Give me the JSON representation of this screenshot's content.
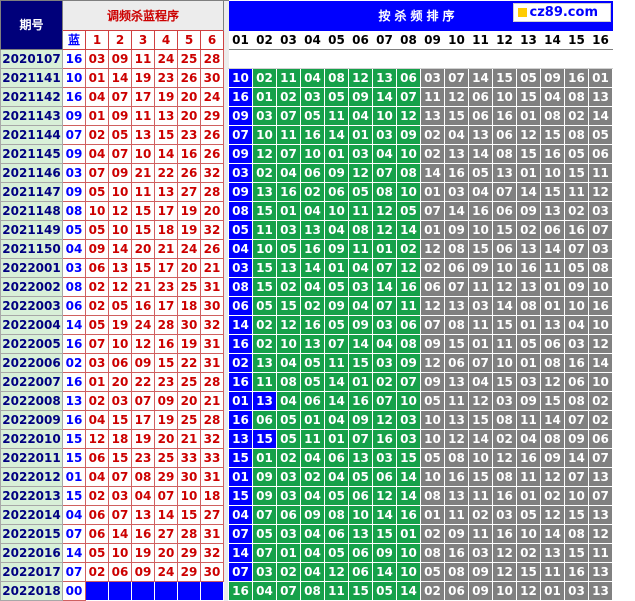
{
  "header": {
    "period_label": "期号",
    "adjust_label": "调频杀蓝程序",
    "kill_label": "按杀频排序",
    "logo_text": "cz89.com",
    "blue_col_label": "蓝",
    "rank_labels": [
      "1",
      "2",
      "3",
      "4",
      "5",
      "6"
    ],
    "kill_col_labels": [
      "01",
      "02",
      "03",
      "04",
      "05",
      "06",
      "07",
      "08",
      "09",
      "10",
      "11",
      "12",
      "13",
      "14",
      "15",
      "16"
    ]
  },
  "colors": {
    "blue": "#0000ff",
    "green": "#16a14a",
    "gray": "#808080",
    "period_bg": "#d8f0d8",
    "red_text": "#cc0000"
  },
  "subheader_period": "2020107",
  "subheader_values": [
    "16",
    "03",
    "09",
    "11",
    "24",
    "25",
    "28"
  ],
  "rows": [
    {
      "period": "2021141",
      "blue": "10",
      "reds": [
        "01",
        "14",
        "19",
        "23",
        "26",
        "30"
      ],
      "kill": [
        "10",
        "02",
        "11",
        "04",
        "08",
        "12",
        "13",
        "06",
        "03",
        "07",
        "14",
        "15",
        "05",
        "09",
        "16",
        "01"
      ],
      "split": [
        1,
        8
      ]
    },
    {
      "period": "2021142",
      "blue": "16",
      "reds": [
        "04",
        "07",
        "17",
        "19",
        "20",
        "24"
      ],
      "kill": [
        "16",
        "01",
        "02",
        "03",
        "05",
        "09",
        "14",
        "07",
        "11",
        "12",
        "06",
        "10",
        "15",
        "04",
        "08",
        "13"
      ],
      "split": [
        1,
        8
      ]
    },
    {
      "period": "2021143",
      "blue": "09",
      "reds": [
        "01",
        "09",
        "11",
        "13",
        "20",
        "29"
      ],
      "kill": [
        "09",
        "03",
        "07",
        "05",
        "11",
        "04",
        "10",
        "12",
        "13",
        "15",
        "06",
        "16",
        "01",
        "08",
        "02",
        "14"
      ],
      "split": [
        1,
        8
      ]
    },
    {
      "period": "2021144",
      "blue": "07",
      "reds": [
        "02",
        "05",
        "13",
        "15",
        "23",
        "26"
      ],
      "kill": [
        "07",
        "10",
        "11",
        "16",
        "14",
        "01",
        "03",
        "09",
        "02",
        "04",
        "13",
        "06",
        "12",
        "15",
        "08",
        "05"
      ],
      "split": [
        1,
        8
      ]
    },
    {
      "period": "2021145",
      "blue": "09",
      "reds": [
        "04",
        "07",
        "10",
        "14",
        "16",
        "26"
      ],
      "kill": [
        "09",
        "12",
        "07",
        "10",
        "01",
        "03",
        "04",
        "10",
        "02",
        "13",
        "14",
        "08",
        "15",
        "16",
        "05",
        "06"
      ],
      "split": [
        1,
        8
      ]
    },
    {
      "period": "2021146",
      "blue": "03",
      "reds": [
        "07",
        "09",
        "21",
        "22",
        "26",
        "32"
      ],
      "kill": [
        "03",
        "02",
        "04",
        "06",
        "09",
        "12",
        "07",
        "08",
        "14",
        "16",
        "05",
        "13",
        "01",
        "10",
        "15",
        "11"
      ],
      "split": [
        1,
        8
      ]
    },
    {
      "period": "2021147",
      "blue": "09",
      "reds": [
        "05",
        "10",
        "11",
        "13",
        "27",
        "28"
      ],
      "kill": [
        "09",
        "13",
        "16",
        "02",
        "06",
        "05",
        "08",
        "10",
        "01",
        "03",
        "04",
        "07",
        "14",
        "15",
        "11",
        "12"
      ],
      "split": [
        1,
        8
      ]
    },
    {
      "period": "2021148",
      "blue": "08",
      "reds": [
        "10",
        "12",
        "15",
        "17",
        "19",
        "20"
      ],
      "kill": [
        "08",
        "15",
        "01",
        "04",
        "10",
        "11",
        "12",
        "05",
        "07",
        "14",
        "16",
        "06",
        "09",
        "13",
        "02",
        "03"
      ],
      "split": [
        1,
        8
      ]
    },
    {
      "period": "2021149",
      "blue": "05",
      "reds": [
        "05",
        "10",
        "15",
        "18",
        "19",
        "32"
      ],
      "kill": [
        "05",
        "11",
        "03",
        "13",
        "04",
        "08",
        "12",
        "14",
        "01",
        "09",
        "10",
        "15",
        "02",
        "06",
        "16",
        "07"
      ],
      "split": [
        1,
        8
      ]
    },
    {
      "period": "2021150",
      "blue": "04",
      "reds": [
        "09",
        "14",
        "20",
        "21",
        "24",
        "26"
      ],
      "kill": [
        "04",
        "10",
        "05",
        "16",
        "09",
        "11",
        "01",
        "02",
        "12",
        "08",
        "15",
        "06",
        "13",
        "14",
        "07",
        "03"
      ],
      "split": [
        1,
        8
      ]
    },
    {
      "period": "2022001",
      "blue": "03",
      "reds": [
        "06",
        "13",
        "15",
        "17",
        "20",
        "21"
      ],
      "kill": [
        "03",
        "15",
        "13",
        "14",
        "01",
        "04",
        "07",
        "12",
        "02",
        "06",
        "09",
        "10",
        "16",
        "11",
        "05",
        "08"
      ],
      "split": [
        1,
        8
      ]
    },
    {
      "period": "2022002",
      "blue": "08",
      "reds": [
        "02",
        "12",
        "21",
        "23",
        "25",
        "31"
      ],
      "kill": [
        "08",
        "15",
        "02",
        "04",
        "05",
        "03",
        "14",
        "16",
        "06",
        "07",
        "11",
        "12",
        "13",
        "01",
        "09",
        "10"
      ],
      "split": [
        1,
        8
      ]
    },
    {
      "period": "2022003",
      "blue": "06",
      "reds": [
        "02",
        "05",
        "16",
        "17",
        "18",
        "30"
      ],
      "kill": [
        "06",
        "05",
        "15",
        "02",
        "09",
        "04",
        "07",
        "11",
        "12",
        "13",
        "03",
        "14",
        "08",
        "01",
        "10",
        "16"
      ],
      "split": [
        1,
        8
      ]
    },
    {
      "period": "2022004",
      "blue": "14",
      "reds": [
        "05",
        "19",
        "24",
        "28",
        "30",
        "32"
      ],
      "kill": [
        "14",
        "02",
        "12",
        "16",
        "05",
        "09",
        "03",
        "06",
        "07",
        "08",
        "11",
        "15",
        "01",
        "13",
        "04",
        "10"
      ],
      "split": [
        1,
        8
      ]
    },
    {
      "period": "2022005",
      "blue": "16",
      "reds": [
        "07",
        "10",
        "12",
        "16",
        "19",
        "31"
      ],
      "kill": [
        "16",
        "02",
        "10",
        "13",
        "07",
        "14",
        "04",
        "08",
        "09",
        "15",
        "01",
        "11",
        "05",
        "06",
        "03",
        "12"
      ],
      "split": [
        1,
        8
      ]
    },
    {
      "period": "2022006",
      "blue": "02",
      "reds": [
        "03",
        "06",
        "09",
        "15",
        "22",
        "31"
      ],
      "kill": [
        "02",
        "13",
        "04",
        "05",
        "11",
        "15",
        "03",
        "09",
        "12",
        "06",
        "07",
        "10",
        "01",
        "08",
        "16",
        "14"
      ],
      "split": [
        1,
        8
      ]
    },
    {
      "period": "2022007",
      "blue": "16",
      "reds": [
        "01",
        "20",
        "22",
        "23",
        "25",
        "28"
      ],
      "kill": [
        "16",
        "11",
        "08",
        "05",
        "14",
        "01",
        "02",
        "07",
        "09",
        "13",
        "04",
        "15",
        "03",
        "12",
        "06",
        "10"
      ],
      "split": [
        1,
        8
      ]
    },
    {
      "period": "2022008",
      "blue": "13",
      "reds": [
        "02",
        "03",
        "07",
        "09",
        "20",
        "21"
      ],
      "kill": [
        "01",
        "13",
        "04",
        "06",
        "14",
        "16",
        "07",
        "10",
        "05",
        "11",
        "12",
        "03",
        "09",
        "15",
        "08",
        "02"
      ],
      "split": [
        2,
        8
      ]
    },
    {
      "period": "2022009",
      "blue": "16",
      "reds": [
        "04",
        "15",
        "17",
        "19",
        "25",
        "28"
      ],
      "kill": [
        "16",
        "06",
        "05",
        "01",
        "04",
        "09",
        "12",
        "03",
        "10",
        "13",
        "15",
        "08",
        "11",
        "14",
        "07",
        "02"
      ],
      "split": [
        1,
        8
      ]
    },
    {
      "period": "2022010",
      "blue": "15",
      "reds": [
        "12",
        "18",
        "19",
        "20",
        "21",
        "32"
      ],
      "kill": [
        "13",
        "15",
        "05",
        "11",
        "01",
        "07",
        "16",
        "03",
        "10",
        "12",
        "14",
        "02",
        "04",
        "08",
        "09",
        "06"
      ],
      "split": [
        2,
        8
      ]
    },
    {
      "period": "2022011",
      "blue": "15",
      "reds": [
        "06",
        "15",
        "23",
        "25",
        "33",
        "33"
      ],
      "kill": [
        "15",
        "01",
        "02",
        "04",
        "06",
        "13",
        "03",
        "15",
        "05",
        "08",
        "10",
        "12",
        "16",
        "09",
        "14",
        "07"
      ],
      "split": [
        1,
        8
      ]
    },
    {
      "period": "2022012",
      "blue": "01",
      "reds": [
        "04",
        "07",
        "08",
        "29",
        "30",
        "31"
      ],
      "kill": [
        "01",
        "09",
        "03",
        "02",
        "04",
        "05",
        "06",
        "14",
        "10",
        "16",
        "15",
        "08",
        "11",
        "12",
        "07",
        "13"
      ],
      "split": [
        1,
        8
      ]
    },
    {
      "period": "2022013",
      "blue": "15",
      "reds": [
        "02",
        "03",
        "04",
        "07",
        "10",
        "18"
      ],
      "kill": [
        "15",
        "09",
        "03",
        "04",
        "05",
        "06",
        "12",
        "14",
        "08",
        "13",
        "11",
        "16",
        "01",
        "02",
        "10",
        "07"
      ],
      "split": [
        1,
        8
      ]
    },
    {
      "period": "2022014",
      "blue": "04",
      "reds": [
        "06",
        "07",
        "13",
        "14",
        "15",
        "27"
      ],
      "kill": [
        "04",
        "07",
        "06",
        "09",
        "08",
        "10",
        "14",
        "16",
        "01",
        "11",
        "02",
        "03",
        "05",
        "12",
        "15",
        "13"
      ],
      "split": [
        1,
        8
      ]
    },
    {
      "period": "2022015",
      "blue": "07",
      "reds": [
        "06",
        "14",
        "16",
        "27",
        "28",
        "31"
      ],
      "kill": [
        "07",
        "05",
        "03",
        "04",
        "06",
        "13",
        "15",
        "01",
        "02",
        "09",
        "11",
        "16",
        "10",
        "14",
        "08",
        "12"
      ],
      "split": [
        1,
        8
      ]
    },
    {
      "period": "2022016",
      "blue": "14",
      "reds": [
        "05",
        "10",
        "19",
        "20",
        "29",
        "32"
      ],
      "kill": [
        "14",
        "07",
        "01",
        "04",
        "05",
        "06",
        "09",
        "10",
        "08",
        "16",
        "03",
        "12",
        "02",
        "13",
        "15",
        "11"
      ],
      "split": [
        1,
        8
      ]
    },
    {
      "period": "2022017",
      "blue": "07",
      "reds": [
        "02",
        "06",
        "09",
        "24",
        "29",
        "30"
      ],
      "kill": [
        "07",
        "03",
        "02",
        "04",
        "12",
        "06",
        "14",
        "10",
        "05",
        "08",
        "09",
        "12",
        "15",
        "11",
        "16",
        "13"
      ],
      "split": [
        1,
        8
      ]
    }
  ],
  "last_row": {
    "period": "2022018",
    "blue": "00",
    "kill": [
      "16",
      "04",
      "07",
      "08",
      "11",
      "15",
      "05",
      "14",
      "02",
      "06",
      "09",
      "10",
      "12",
      "01",
      "03",
      "13"
    ]
  }
}
